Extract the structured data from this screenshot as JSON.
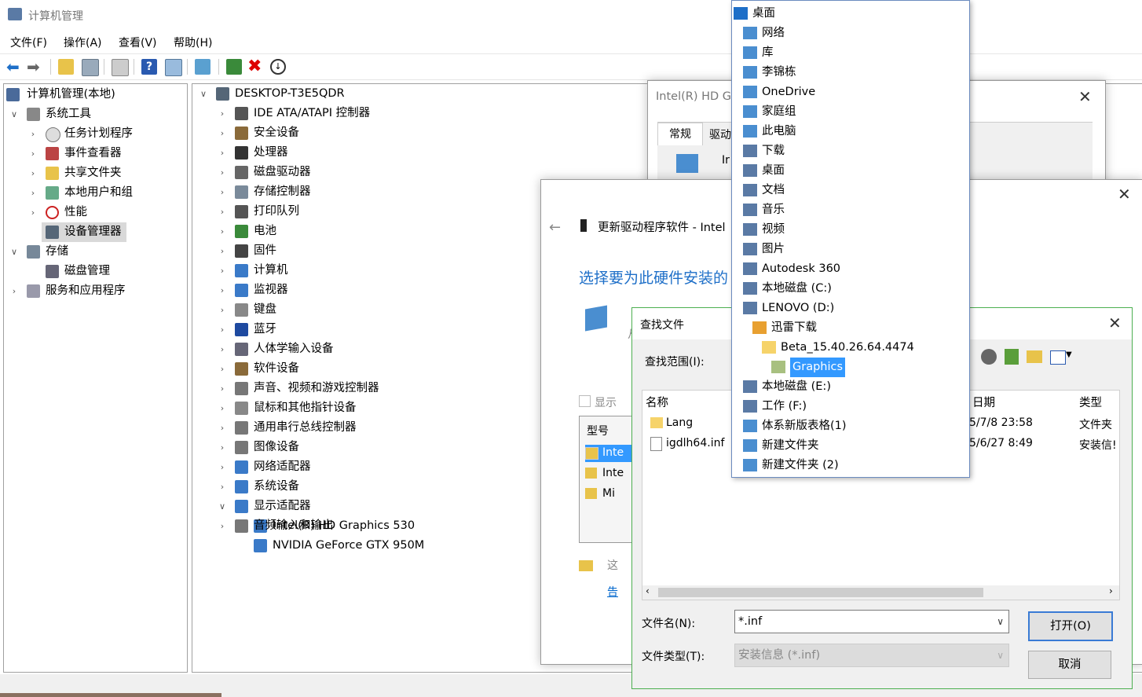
{
  "main_window": {
    "title": "计算机管理",
    "menu": [
      "文件(F)",
      "操作(A)",
      "查看(V)",
      "帮助(H)"
    ],
    "left_tree": [
      {
        "label": "计算机管理(本地)",
        "indent": 0
      },
      {
        "label": "系统工具",
        "indent": 1,
        "expanded": true
      },
      {
        "label": "任务计划程序",
        "indent": 2
      },
      {
        "label": "事件查看器",
        "indent": 2
      },
      {
        "label": "共享文件夹",
        "indent": 2
      },
      {
        "label": "本地用户和组",
        "indent": 2
      },
      {
        "label": "性能",
        "indent": 2
      },
      {
        "label": "设备管理器",
        "indent": 2,
        "selected": true
      },
      {
        "label": "存储",
        "indent": 1,
        "expanded": true
      },
      {
        "label": "磁盘管理",
        "indent": 2
      },
      {
        "label": "服务和应用程序",
        "indent": 1
      }
    ],
    "device_tree": {
      "root": "DESKTOP-T3E5QDR",
      "items": [
        "IDE ATA/ATAPI 控制器",
        "安全设备",
        "处理器",
        "磁盘驱动器",
        "存储控制器",
        "打印队列",
        "电池",
        "固件",
        "计算机",
        "监视器",
        "键盘",
        "蓝牙",
        "人体学输入设备",
        "软件设备",
        "声音、视频和游戏控制器",
        "鼠标和其他指针设备",
        "通用串行总线控制器",
        "图像设备",
        "网络适配器",
        "系统设备",
        "显示适配器"
      ],
      "display_children": [
        "Intel(R) HD Graphics 530",
        "NVIDIA GeForce GTX 950M"
      ],
      "last": "音频输入和输出"
    }
  },
  "props_dialog": {
    "title": "Intel(R) HD G",
    "tabs": [
      "常规",
      "驱动"
    ],
    "snippet": "Ir"
  },
  "update_dialog": {
    "title": "更新驱动程序软件 - Intel",
    "heading": "选择要为此硬件安装的",
    "show_compat": "显示",
    "model_header": "型号",
    "models": [
      "Inte",
      "Inte",
      "Mi"
    ],
    "note": "这",
    "link": "告",
    "small_text": "从"
  },
  "find_dialog": {
    "title": "查找文件",
    "lookin_label": "查找范围(I):",
    "columns": [
      "名称",
      "日期",
      "类型"
    ],
    "files": [
      {
        "name": "Lang",
        "date": "5/7/8 23:58",
        "type": "文件夹"
      },
      {
        "name": "igdlh64.inf",
        "date": "5/6/27 8:49",
        "type": "安装信!"
      }
    ],
    "filename_label": "文件名(N):",
    "filename_value": "*.inf",
    "filetype_label": "文件类型(T):",
    "filetype_value": "安装信息 (*.inf)",
    "open_button": "打开(O)",
    "cancel_button": "取消"
  },
  "location_dropdown": [
    {
      "label": "桌面",
      "level": 0
    },
    {
      "label": "网络",
      "level": 1
    },
    {
      "label": "库",
      "level": 1
    },
    {
      "label": "李锦栋",
      "level": 1
    },
    {
      "label": "OneDrive",
      "level": 1
    },
    {
      "label": "家庭组",
      "level": 1
    },
    {
      "label": "此电脑",
      "level": 1
    },
    {
      "label": "下载",
      "level": 2
    },
    {
      "label": "桌面",
      "level": 2
    },
    {
      "label": "文档",
      "level": 2
    },
    {
      "label": "音乐",
      "level": 2
    },
    {
      "label": "视频",
      "level": 2
    },
    {
      "label": "图片",
      "level": 2
    },
    {
      "label": "Autodesk 360",
      "level": 2
    },
    {
      "label": "本地磁盘 (C:)",
      "level": 2
    },
    {
      "label": "LENOVO (D:)",
      "level": 2
    },
    {
      "label": "迅雷下载",
      "level": 3
    },
    {
      "label": "Beta_15.40.26.64.4474",
      "level": 4
    },
    {
      "label": "Graphics",
      "level": 5,
      "selected": true
    },
    {
      "label": "本地磁盘 (E:)",
      "level": 2
    },
    {
      "label": "工作 (F:)",
      "level": 2
    },
    {
      "label": "体系新版表格(1)",
      "level": 1
    },
    {
      "label": "新建文件夹",
      "level": 1
    },
    {
      "label": "新建文件夹 (2)",
      "level": 1
    }
  ],
  "colors": {
    "accent_blue": "#1e6fc8",
    "selection": "#3399ff",
    "link": "#0066cc"
  }
}
